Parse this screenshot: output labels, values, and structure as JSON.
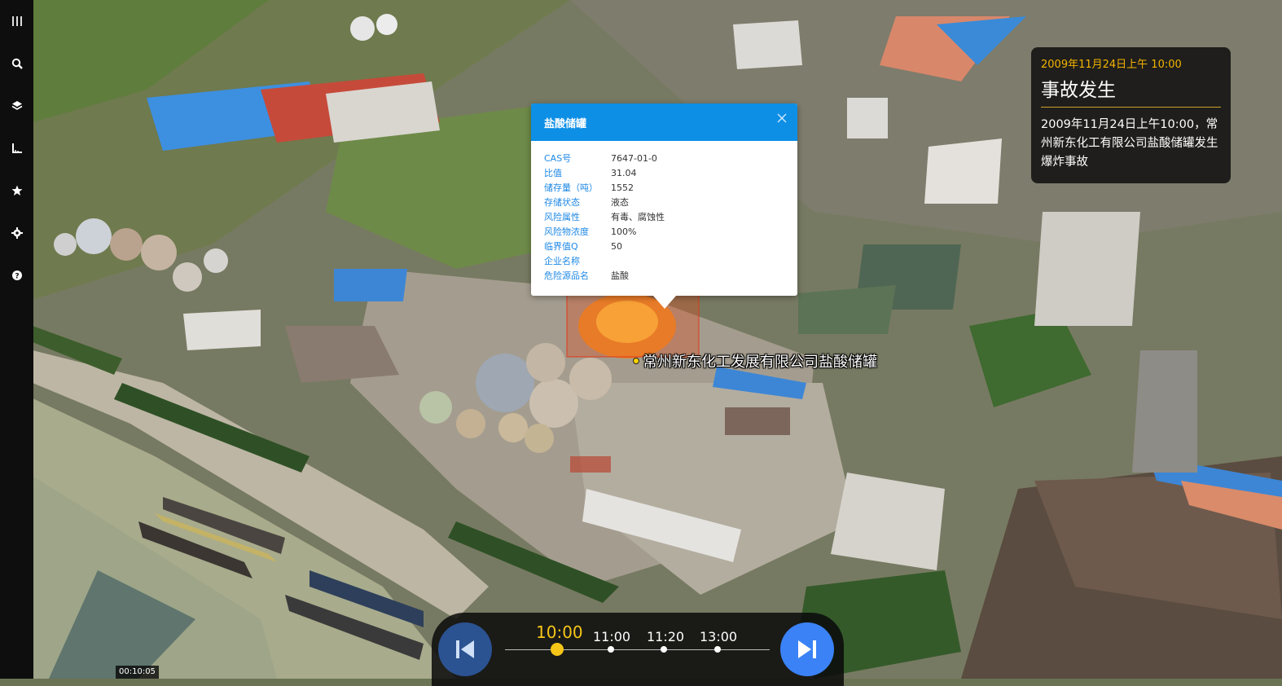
{
  "toolbar": {
    "items": [
      {
        "icon": "layout-icon",
        "label": "layout"
      },
      {
        "icon": "search-icon",
        "label": "search"
      },
      {
        "icon": "layers-icon",
        "label": "layers"
      },
      {
        "icon": "measure-icon",
        "label": "measure"
      },
      {
        "icon": "star-icon",
        "label": "favorites"
      },
      {
        "icon": "gear-icon",
        "label": "settings"
      },
      {
        "icon": "help-icon",
        "label": "help"
      }
    ]
  },
  "popup": {
    "title": "盐酸储罐",
    "rows": [
      {
        "key": "CAS号",
        "value": "7647-01-0"
      },
      {
        "key": "比值",
        "value": "31.04"
      },
      {
        "key": "储存量（吨）",
        "value": "1552"
      },
      {
        "key": "存储状态",
        "value": "液态"
      },
      {
        "key": "风险属性",
        "value": "有毒、腐蚀性"
      },
      {
        "key": "风险物浓度",
        "value": "100%"
      },
      {
        "key": "临界值Q",
        "value": "50"
      },
      {
        "key": "企业名称",
        "value": ""
      },
      {
        "key": "危险源品名",
        "value": "盐酸"
      }
    ]
  },
  "map_label": "常州新东化工发展有限公司盐酸储罐",
  "event": {
    "time": "2009年11月24日上午 10:00",
    "title": "事故发生",
    "description": "2009年11月24日上午10:00，常州新东化工有限公司盐酸储罐发生爆炸事故"
  },
  "timeline": {
    "points": [
      {
        "label": "10:00",
        "active": true
      },
      {
        "label": "11:00",
        "active": false
      },
      {
        "label": "11:20",
        "active": false
      },
      {
        "label": "13:00",
        "active": false
      }
    ]
  },
  "clock": "00:10:05",
  "colors": {
    "accent": "#0d8fe6",
    "highlight": "#f5c518",
    "event_time": "#f4b400"
  }
}
